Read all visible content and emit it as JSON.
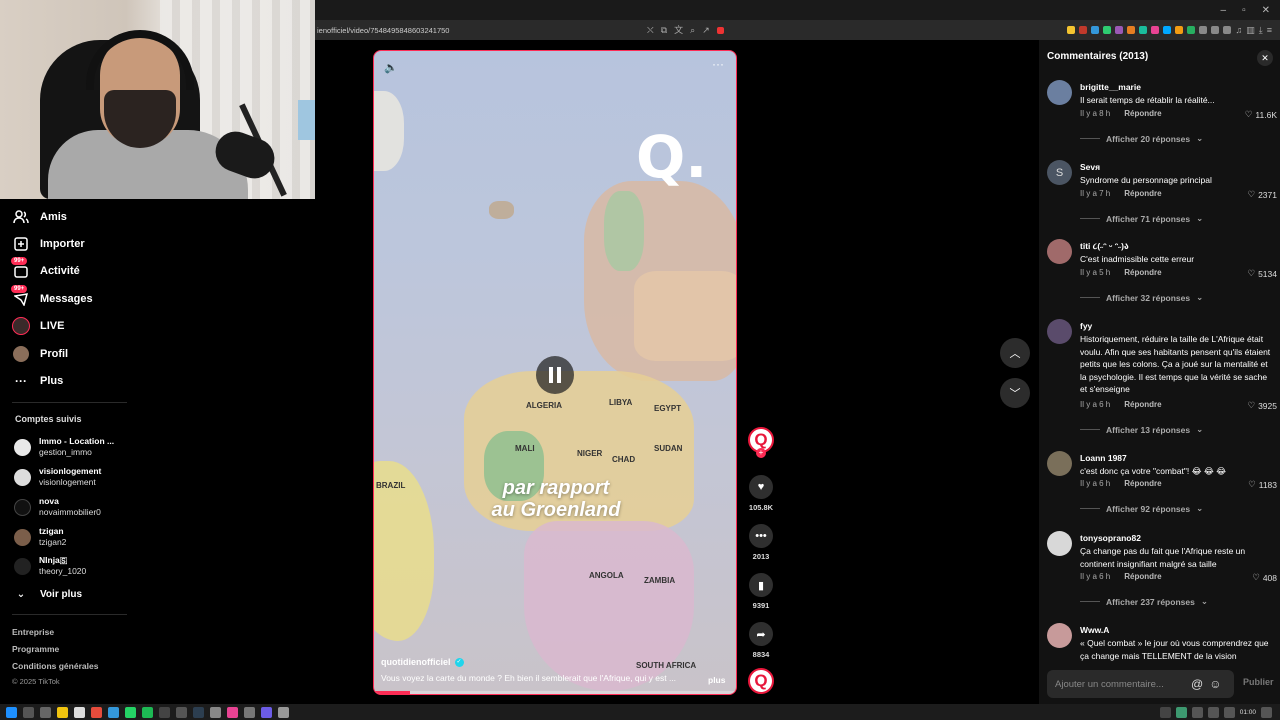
{
  "browser": {
    "url": "ienofficiel/video/7548495848603241750",
    "window_controls": {
      "minimize": "–",
      "restore": "▫",
      "close": "✕"
    }
  },
  "sidebar": {
    "items": [
      {
        "label": "Amis",
        "icon": "friends-icon"
      },
      {
        "label": "Importer",
        "icon": "upload-icon"
      },
      {
        "label": "Activité",
        "icon": "activity-icon",
        "badge": "99+"
      },
      {
        "label": "Messages",
        "icon": "messages-icon",
        "badge": "99+"
      },
      {
        "label": "LIVE",
        "icon": "live-icon"
      },
      {
        "label": "Profil",
        "icon": "profile-icon"
      },
      {
        "label": "Plus",
        "icon": "more-icon"
      }
    ],
    "following_title": "Comptes suivis",
    "following": [
      {
        "name": "Immo - Location ...",
        "handle": "gestion_immo"
      },
      {
        "name": "visionlogement",
        "handle": "visionlogement"
      },
      {
        "name": "nova",
        "handle": "novaimmobilier0"
      },
      {
        "name": "tzigan",
        "handle": "tzigan2"
      },
      {
        "name": "NInja🇸",
        "handle": "theory_1020"
      }
    ],
    "see_more": "Voir plus",
    "footer": [
      "Entreprise",
      "Programme",
      "Conditions générales"
    ],
    "copyright": "© 2025 TikTok"
  },
  "video": {
    "overlay_line1": "par rapport",
    "overlay_line2": "au Groenland",
    "logo": "Q.",
    "author": "quotidienofficiel",
    "caption": "Vous voyez la carte du monde ? Eh bien il semblerait que l'Afrique, qui y est ...",
    "more": "plus",
    "progress_fraction": 0.1,
    "countries": [
      "ALGERIA",
      "LIBYA",
      "EGYPT",
      "MALI",
      "NIGER",
      "CHAD",
      "SUDAN",
      "BRAZIL",
      "SOUTH AFRICA",
      "ZAMBIA",
      "ANGOLA"
    ]
  },
  "actions": {
    "likes": "105.8K",
    "comments": "2013",
    "saves": "9391",
    "shares": "8834"
  },
  "comments_panel": {
    "title": "Commentaires (2013)",
    "reply_label": "Répondre",
    "input_placeholder": "Ajouter un commentaire...",
    "publish": "Publier",
    "items": [
      {
        "user": "brigitte__marie",
        "text": "Il serait temps de rétablir la réalité...",
        "time": "Il y a 8 h",
        "likes": "11.6K",
        "replies": "Afficher 20 réponses",
        "avatar_color": "#6b7fa0"
      },
      {
        "user": "Sevя",
        "text": "Syndrome du personnage principal",
        "time": "Il y a 7 h",
        "likes": "2371",
        "replies": "Afficher 71 réponses",
        "avatar_color": "#4b5563",
        "initial": "S"
      },
      {
        "user": "titi ૮(˶ᵔ ᵕ ᵔ˶)ა",
        "text": "C'est inadmissible cette erreur",
        "time": "Il y a 5 h",
        "likes": "5134",
        "replies": "Afficher 32 réponses",
        "avatar_color": "#a06a6a"
      },
      {
        "user": "fyy",
        "text": "Historiquement, réduire la taille de L'Afrique était voulu. Afin que ses habitants pensent qu'ils étaient petits que les colons. Ça a joué sur la mentalité et la psychologie. Il est temps que la vérité se sache et s'enseigne",
        "time": "Il y a 6 h",
        "likes": "3925",
        "replies": "Afficher 13 réponses",
        "avatar_color": "#5a4b6b"
      },
      {
        "user": "Loann 1987",
        "text": "c'est donc ça votre \"combat\"! 😂 😂 😂",
        "time": "Il y a 6 h",
        "likes": "1183",
        "replies": "Afficher 92 réponses",
        "avatar_color": "#7a6f5a"
      },
      {
        "user": "tonysoprano82",
        "text": "Ça change pas du fait que l'Afrique reste un continent insignifiant malgré sa taille",
        "time": "Il y a 6 h",
        "likes": "408",
        "replies": "Afficher 237 réponses",
        "avatar_color": "#d8d8d8"
      },
      {
        "user": "Www.A",
        "text": "« Quel combat » le jour où vous comprendrez que ça change mais TELLEMENT de la vision",
        "time": "",
        "likes": "",
        "replies": "",
        "avatar_color": "#c79a9a"
      }
    ]
  },
  "taskbar": {
    "time": "01:00"
  }
}
